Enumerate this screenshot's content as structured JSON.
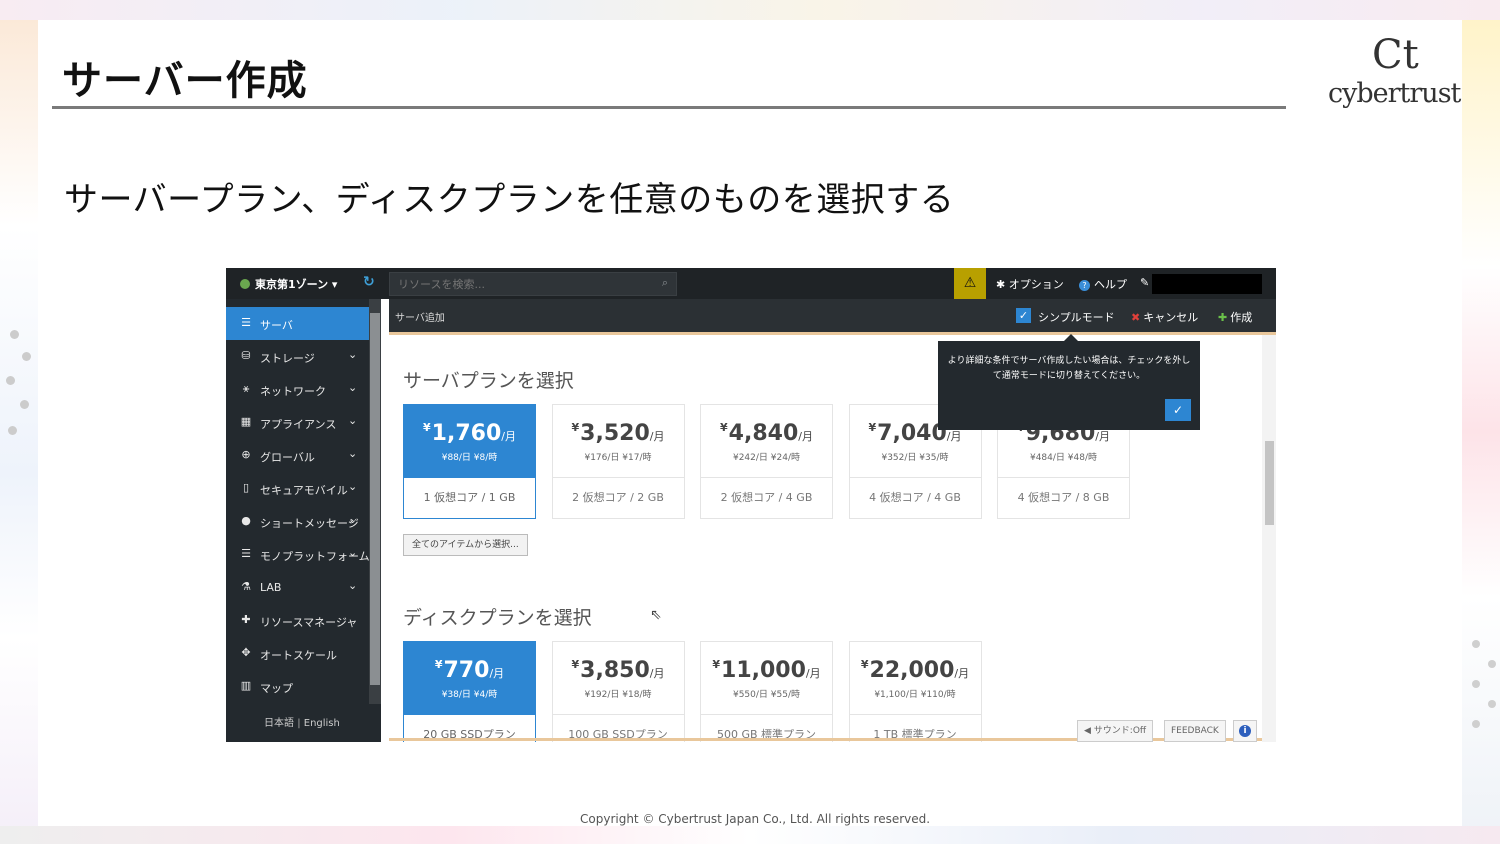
{
  "slide": {
    "title": "サーバー作成",
    "subtitle": "サーバープラン、ディスクプランを任意のものを選択する",
    "logo_mark": "Ct",
    "logo_text": "cybertrust",
    "footer": "Copyright © Cybertrust Japan Co., Ltd. All rights reserved."
  },
  "topbar": {
    "zone": "東京第1ゾーン ▾",
    "search_placeholder": "リソースを検索...",
    "warning": "⚠",
    "options": "オプション",
    "help": "ヘルプ"
  },
  "sidebar": {
    "items": [
      {
        "icon": "server-icon",
        "glyph": "☰",
        "label": "サーバ",
        "active": true,
        "chevron": false
      },
      {
        "icon": "storage-icon",
        "glyph": "⛁",
        "label": "ストレージ",
        "active": false,
        "chevron": true
      },
      {
        "icon": "network-icon",
        "glyph": "⚹",
        "label": "ネットワーク",
        "active": false,
        "chevron": true
      },
      {
        "icon": "appliance-icon",
        "glyph": "▦",
        "label": "アプライアンス",
        "active": false,
        "chevron": true
      },
      {
        "icon": "global-icon",
        "glyph": "⊕",
        "label": "グローバル",
        "active": false,
        "chevron": true
      },
      {
        "icon": "mobile-icon",
        "glyph": "▯",
        "label": "セキュアモバイル",
        "active": false,
        "chevron": true
      },
      {
        "icon": "message-icon",
        "glyph": "●",
        "label": "ショートメッセージ",
        "active": false,
        "chevron": true
      },
      {
        "icon": "monoplatform-icon",
        "glyph": "☰",
        "label": "モノプラットフォーム",
        "active": false,
        "chevron": true
      },
      {
        "icon": "lab-icon",
        "glyph": "⚗",
        "label": "LAB",
        "active": false,
        "chevron": true
      },
      {
        "icon": "resource-manager-icon",
        "glyph": "✚",
        "label": "リソースマネージャ",
        "active": false,
        "chevron": false
      },
      {
        "icon": "autoscale-icon",
        "glyph": "✥",
        "label": "オートスケール",
        "active": false,
        "chevron": false
      },
      {
        "icon": "map-icon",
        "glyph": "▥",
        "label": "マップ",
        "active": false,
        "chevron": false
      }
    ],
    "lang_ja": "日本語",
    "lang_sep": "|",
    "lang_en": "English"
  },
  "subbar": {
    "title": "サーバ追加",
    "simple_mode": "シンプルモード",
    "cancel": "キャンセル",
    "create": "作成"
  },
  "server_plans": {
    "heading": "サーバプランを選択",
    "plans": [
      {
        "price": "1,760",
        "unit": "/月",
        "daily": "88",
        "hourly": "8",
        "spec": "1 仮想コア / 1 GB",
        "selected": true
      },
      {
        "price": "3,520",
        "unit": "/月",
        "daily": "176",
        "hourly": "17",
        "spec": "2 仮想コア / 2 GB",
        "selected": false
      },
      {
        "price": "4,840",
        "unit": "/月",
        "daily": "242",
        "hourly": "24",
        "spec": "2 仮想コア / 4 GB",
        "selected": false
      },
      {
        "price": "7,040",
        "unit": "/月",
        "daily": "352",
        "hourly": "35",
        "spec": "4 仮想コア / 4 GB",
        "selected": false
      },
      {
        "price": "9,680",
        "unit": "/月",
        "daily": "484",
        "hourly": "48",
        "spec": "4 仮想コア / 8 GB",
        "selected": false
      }
    ],
    "all_items": "全てのアイテムから選択..."
  },
  "disk_plans": {
    "heading": "ディスクプランを選択",
    "plans": [
      {
        "price": "770",
        "unit": "/月",
        "daily": "38",
        "hourly": "4",
        "spec": "20 GB SSDプラン",
        "selected": true
      },
      {
        "price": "3,850",
        "unit": "/月",
        "daily": "192",
        "hourly": "18",
        "spec": "100 GB SSDプラン",
        "selected": false
      },
      {
        "price": "11,000",
        "unit": "/月",
        "daily": "550",
        "hourly": "55",
        "spec": "500 GB 標準プラン",
        "selected": false
      },
      {
        "price": "22,000",
        "unit": "/月",
        "daily": "1,100",
        "hourly": "110",
        "spec": "1 TB 標準プラン",
        "selected": false
      }
    ]
  },
  "tooltip": {
    "message": "より詳細な条件でサーバ作成したい場合は、チェックを外して通常モードに切り替えてください。",
    "ok": "✓"
  },
  "footer_buttons": {
    "sound": "サウンド:Off",
    "feedback": "FEEDBACK",
    "info": "i"
  },
  "colors": {
    "accent": "#2d86d2",
    "sidebar_bg": "#23292e",
    "warning_bg": "#b8a000"
  }
}
